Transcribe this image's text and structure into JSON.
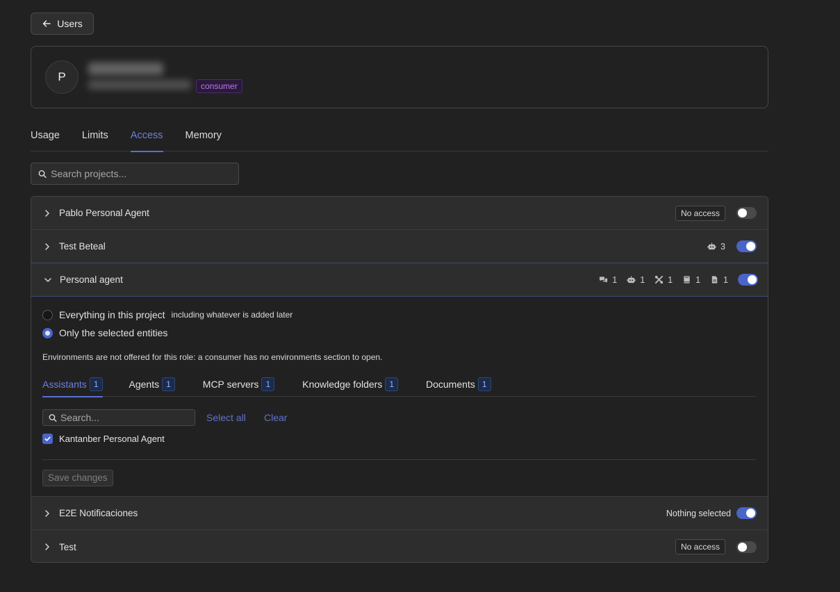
{
  "back_button": {
    "label": "Users"
  },
  "user": {
    "avatar_initial": "P",
    "role_badge": "consumer"
  },
  "tabs": [
    {
      "label": "Usage",
      "active": false
    },
    {
      "label": "Limits",
      "active": false
    },
    {
      "label": "Access",
      "active": true
    },
    {
      "label": "Memory",
      "active": false
    }
  ],
  "project_search": {
    "placeholder": "Search projects..."
  },
  "projects": [
    {
      "name": "Pablo Personal Agent",
      "status": "No access",
      "enabled": false,
      "expanded": false
    },
    {
      "name": "Test Beteal",
      "counts": [
        {
          "icon": "robot-icon",
          "value": "3"
        }
      ],
      "enabled": true,
      "expanded": false
    },
    {
      "name": "Personal agent",
      "enabled": true,
      "expanded": true,
      "counts": [
        {
          "icon": "chat-icon",
          "value": "1"
        },
        {
          "icon": "robot-icon",
          "value": "1"
        },
        {
          "icon": "tools-icon",
          "value": "1"
        },
        {
          "icon": "book-icon",
          "value": "1"
        },
        {
          "icon": "document-icon",
          "value": "1"
        }
      ],
      "scope_options": [
        {
          "label": "Everything in this project",
          "hint": "including whatever is added later",
          "selected": false
        },
        {
          "label": "Only the selected entities",
          "hint": "",
          "selected": true
        }
      ],
      "env_note": "Environments are not offered for this role: a consumer has no environments section to open.",
      "entity_tabs": [
        {
          "label": "Assistants",
          "count": "1",
          "active": true
        },
        {
          "label": "Agents",
          "count": "1",
          "active": false
        },
        {
          "label": "MCP servers",
          "count": "1",
          "active": false
        },
        {
          "label": "Knowledge folders",
          "count": "1",
          "active": false
        },
        {
          "label": "Documents",
          "count": "1",
          "active": false
        }
      ],
      "entity_search": {
        "placeholder": "Search..."
      },
      "select_all_label": "Select all",
      "clear_label": "Clear",
      "entities": [
        {
          "label": "Kantanber Personal Agent",
          "checked": true
        }
      ],
      "save_label": "Save changes"
    },
    {
      "name": "E2E Notificaciones",
      "status": "Nothing selected",
      "enabled": true,
      "expanded": false
    },
    {
      "name": "Test",
      "status": "No access",
      "enabled": false,
      "expanded": false
    }
  ],
  "colors": {
    "background": "#212121",
    "accent": "#4b64c8",
    "accent_text": "#6d7fe0",
    "role_badge": "#b47be8"
  }
}
